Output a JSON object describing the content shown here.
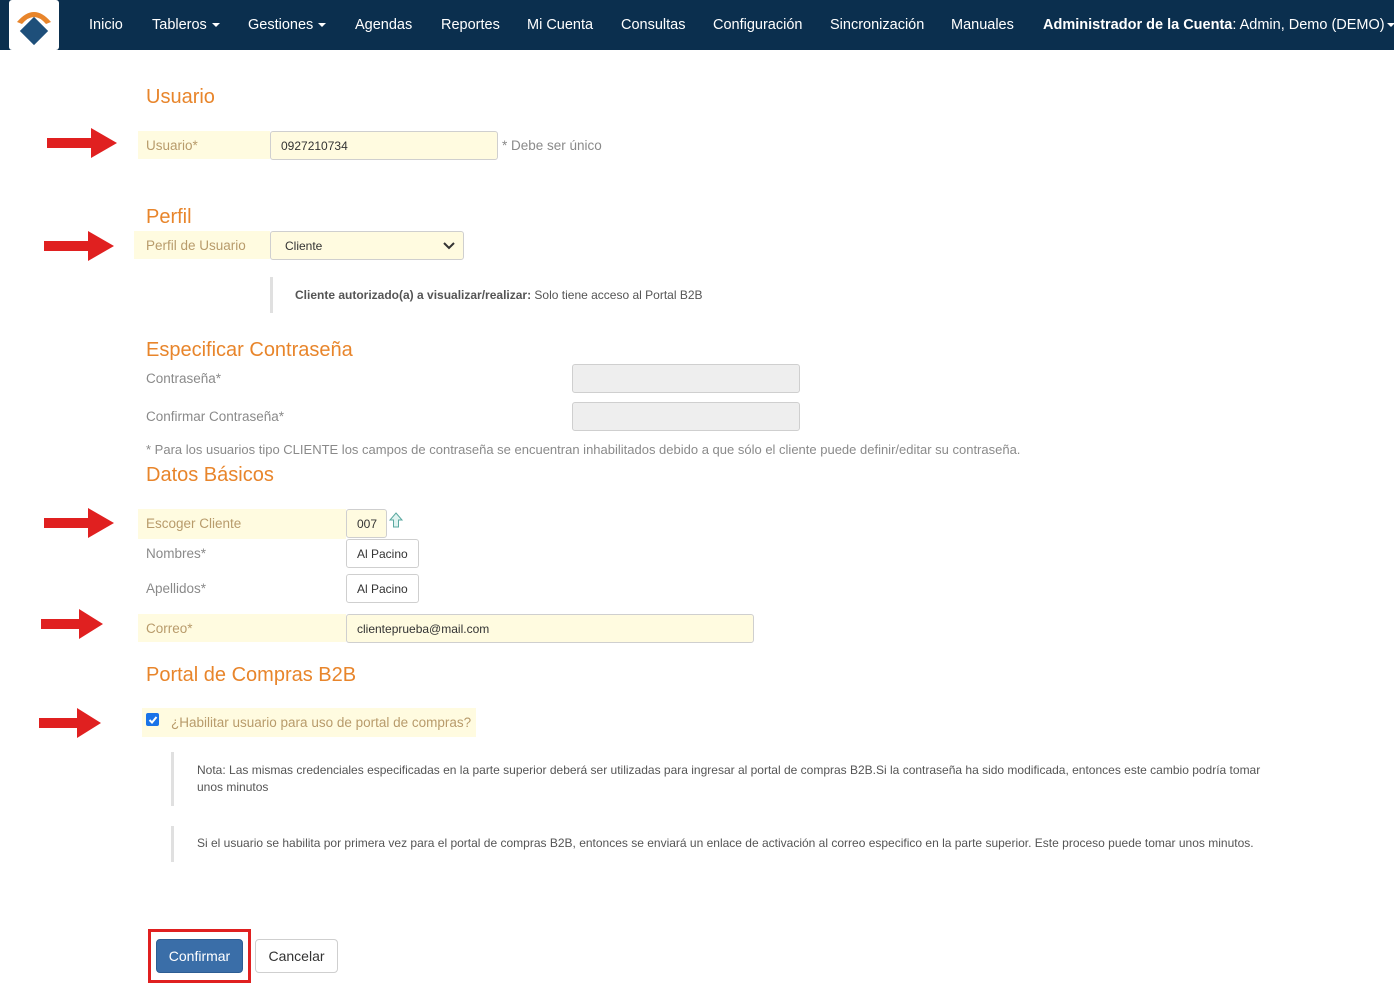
{
  "navbar": {
    "items": [
      {
        "label": "Inicio"
      },
      {
        "label": "Tableros"
      },
      {
        "label": "Gestiones"
      },
      {
        "label": "Agendas"
      },
      {
        "label": "Reportes"
      },
      {
        "label": "Mi Cuenta"
      },
      {
        "label": "Consultas"
      },
      {
        "label": "Configuración"
      },
      {
        "label": "Sincronización"
      },
      {
        "label": "Manuales"
      }
    ],
    "account_bold": "Administrador de la Cuenta",
    "account_rest": ": Admin, Demo (DEMO)",
    "brand_colors": {
      "orange": "#e8852b",
      "blue": "#1e4f7a",
      "bg": "#0b2f4e"
    }
  },
  "usuario": {
    "title": "Usuario",
    "label": "Usuario*",
    "value": "0927210734",
    "hint": "* Debe ser único"
  },
  "perfil": {
    "title": "Perfil",
    "label": "Perfil de Usuario",
    "selected": "Cliente",
    "note_bold": "Cliente autorizado(a) a visualizar/realizar:",
    "note_text": " Solo tiene acceso al Portal B2B"
  },
  "password": {
    "title": "Especificar Contraseña",
    "label": "Contraseña*",
    "confirm_label": "Confirmar Contraseña*",
    "note": "* Para los usuarios tipo CLIENTE los campos de contraseña se encuentran inhabilitados debido a que sólo el cliente puede definir/editar su contraseña."
  },
  "datos": {
    "title": "Datos Básicos",
    "cliente_label": "Escoger Cliente",
    "cliente_value": "007",
    "nombres_label": "Nombres*",
    "nombres_value": "Al Pacino",
    "apellidos_label": "Apellidos*",
    "apellidos_value": "Al Pacino",
    "correo_label": "Correo*",
    "correo_value": "clienteprueba@mail.com"
  },
  "portal": {
    "title": "Portal de Compras B2B",
    "checkbox_label": "¿Habilitar usuario para uso de portal de compras?",
    "checked": true,
    "note1": "Nota: Las mismas credenciales especificadas en la parte superior deberá ser utilizadas para ingresar al portal de compras B2B.Si la contraseña ha sido modificada, entonces este cambio podría tomar unos minutos",
    "note2": "Si el usuario se habilita por primera vez para el portal de compras B2B, entonces se enviará un enlace de activación al correo especifico en la parte superior. Este proceso puede tomar unos minutos."
  },
  "actions": {
    "confirm": "Confirmar",
    "cancel": "Cancelar"
  }
}
